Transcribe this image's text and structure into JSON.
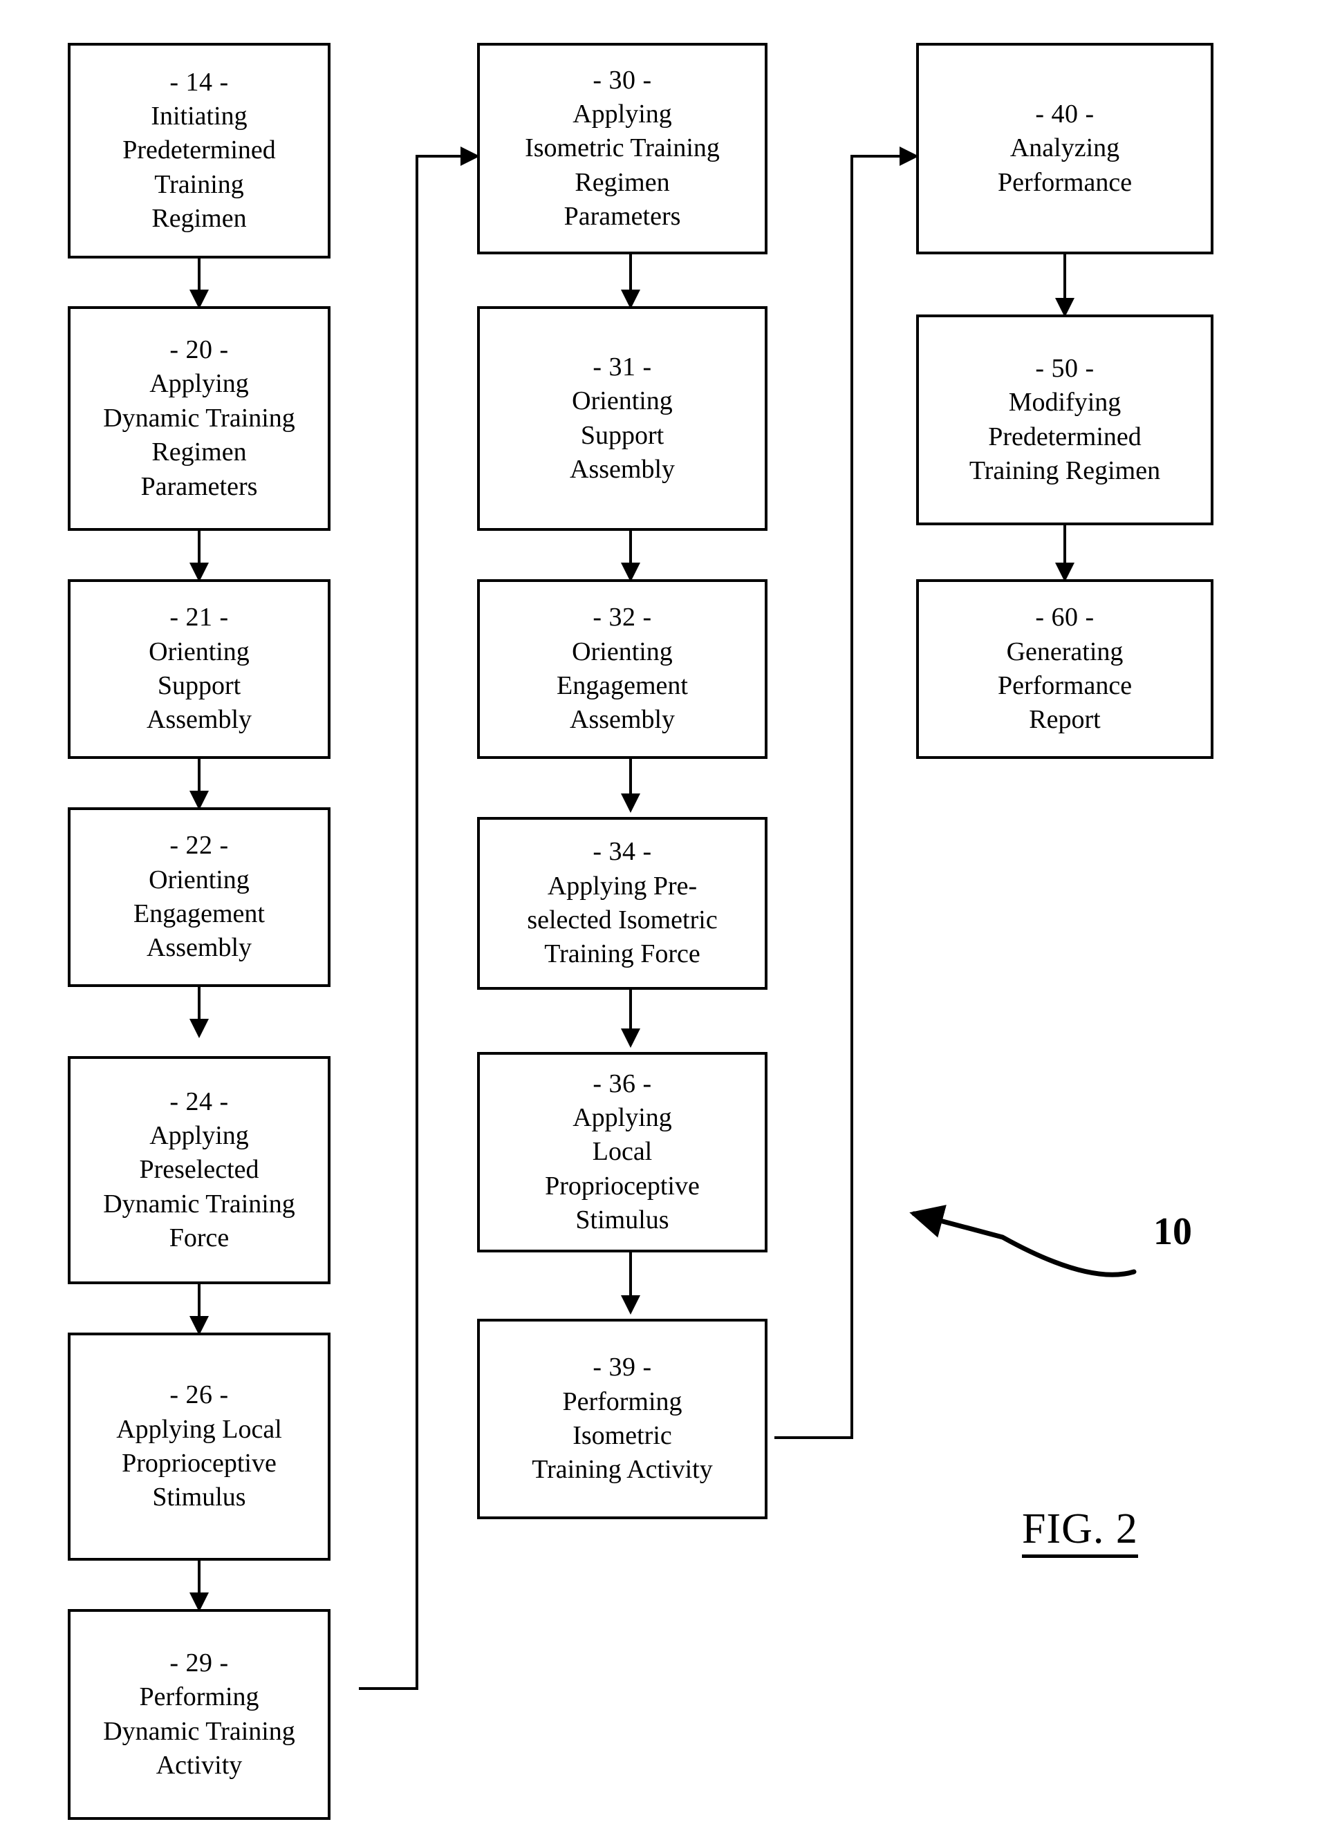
{
  "figure": {
    "caption": "FIG. 2",
    "reference_number": "10"
  },
  "columns": [
    {
      "name": "dynamic-training-column",
      "boxes": [
        {
          "ref": "- 14 -",
          "label": "Initiating\nPredetermined\nTraining\nRegimen"
        },
        {
          "ref": "- 20 -",
          "label": "Applying\nDynamic Training\nRegimen\nParameters"
        },
        {
          "ref": "- 21 -",
          "label": "Orienting\nSupport\nAssembly"
        },
        {
          "ref": "- 22 -",
          "label": "Orienting\nEngagement\nAssembly"
        },
        {
          "ref": "- 24 -",
          "label": "Applying\nPreselected\nDynamic Training\nForce"
        },
        {
          "ref": "- 26 -",
          "label": "Applying Local\nProprioceptive\nStimulus"
        },
        {
          "ref": "- 29 -",
          "label": "Performing\nDynamic Training\nActivity"
        }
      ]
    },
    {
      "name": "isometric-training-column",
      "boxes": [
        {
          "ref": "- 30 -",
          "label": "Applying\nIsometric Training\nRegimen\nParameters"
        },
        {
          "ref": "- 31 -",
          "label": "Orienting\nSupport\nAssembly"
        },
        {
          "ref": "- 32 -",
          "label": "Orienting\nEngagement\nAssembly"
        },
        {
          "ref": "- 34 -",
          "label": "Applying Pre-\nselected Isometric\nTraining Force"
        },
        {
          "ref": "- 36 -",
          "label": "Applying\nLocal\nProprioceptive\nStimulus"
        },
        {
          "ref": "- 39 -",
          "label": "Performing\nIsometric\nTraining Activity"
        }
      ]
    },
    {
      "name": "performance-analysis-column",
      "boxes": [
        {
          "ref": "- 40 -",
          "label": "Analyzing\nPerformance"
        },
        {
          "ref": "- 50 -",
          "label": "Modifying\nPredetermined\nTraining Regimen"
        },
        {
          "ref": "- 60 -",
          "label": "Generating\nPerformance\nReport"
        }
      ]
    }
  ]
}
